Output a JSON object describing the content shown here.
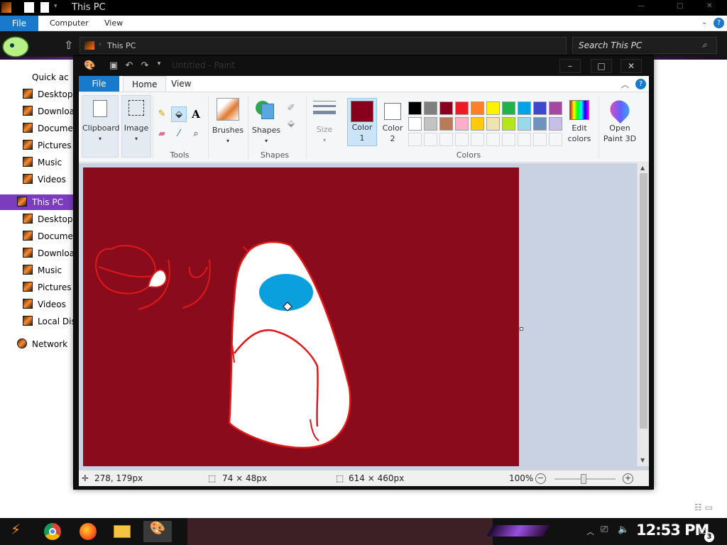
{
  "explorer": {
    "title": "This PC",
    "ribbon_tabs": {
      "file": "File",
      "computer": "Computer",
      "view": "View"
    },
    "address": "This PC",
    "search_placeholder": "Search This PC",
    "nav": {
      "quick_access": "Quick access",
      "quick_items": [
        "Desktop",
        "Downloads",
        "Documents",
        "Pictures",
        "Music",
        "Videos"
      ],
      "this_pc": "This PC",
      "pc_items": [
        "Desktop",
        "Documents",
        "Downloads",
        "Music",
        "Pictures",
        "Videos",
        "Local Disk"
      ],
      "network": "Network"
    }
  },
  "paint": {
    "title": "Untitled - Paint",
    "window_controls": {
      "minimize": "–",
      "maximize": "□",
      "close": "✕"
    },
    "menu": {
      "file": "File",
      "home": "Home",
      "view": "View"
    },
    "ribbon": {
      "clipboard": "Clipboard",
      "image": "Image",
      "tools_group": "Tools",
      "brushes": "Brushes",
      "shapes": "Shapes",
      "shapes_group": "Shapes",
      "size": "Size",
      "color1_line1": "Color",
      "color1_line2": "1",
      "color2_line1": "Color",
      "color2_line2": "2",
      "edit_colors_line1": "Edit",
      "edit_colors_line2": "colors",
      "open_paint3d_line1": "Open",
      "open_paint3d_line2": "Paint 3D",
      "colors_group": "Colors",
      "text_tool": "A"
    },
    "color1": "#88001b",
    "color2": "#ffffff",
    "palette_row1": [
      "#000000",
      "#7f7f7f",
      "#88001b",
      "#ed1c24",
      "#ff7f27",
      "#fff200",
      "#22b14c",
      "#00a2e8",
      "#3f48cc",
      "#a349a4"
    ],
    "palette_row2": [
      "#ffffff",
      "#c3c3c3",
      "#b97a57",
      "#ffaec9",
      "#ffc90e",
      "#efe4b0",
      "#b5e61d",
      "#99d9ea",
      "#7092be",
      "#c8bfe7"
    ],
    "canvas_color": "#8a0b1c",
    "status": {
      "cursor_pos": "278, 179px",
      "selection_size": "74 × 48px",
      "canvas_size": "614 × 460px",
      "zoom": "100%",
      "zoom_out": "−",
      "zoom_in": "+"
    }
  },
  "taskbar": {
    "clock": "12:53 PM",
    "notification_count": "3"
  }
}
